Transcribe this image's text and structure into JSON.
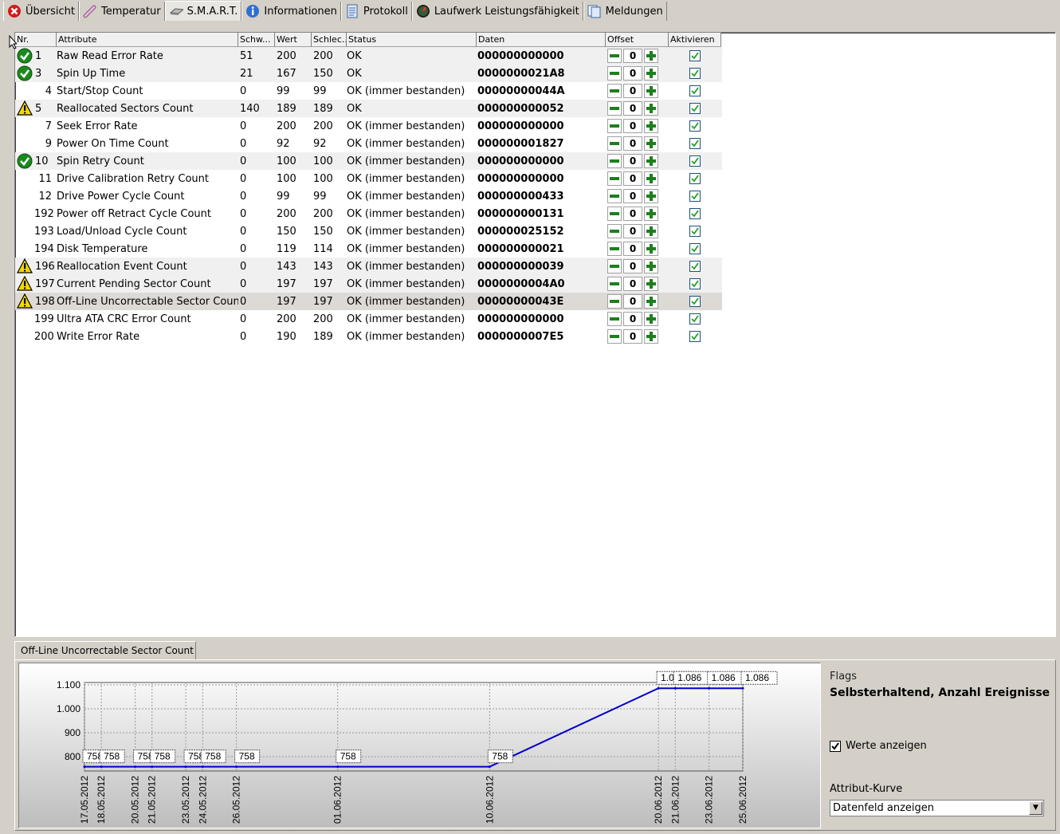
{
  "tabs": [
    {
      "label": "Übersicht",
      "icon": "error-icon"
    },
    {
      "label": "Temperatur",
      "icon": "thermometer-icon"
    },
    {
      "label": "S.M.A.R.T.",
      "icon": "drive-icon",
      "active": true
    },
    {
      "label": "Informationen",
      "icon": "info-icon"
    },
    {
      "label": "Protokoll",
      "icon": "document-icon"
    },
    {
      "label": "Laufwerk Leistungsfähigkeit",
      "icon": "gauge-icon"
    },
    {
      "label": "Meldungen",
      "icon": "messages-icon"
    }
  ],
  "table": {
    "headers": [
      "Nr.",
      "Attribute",
      "Schw...",
      "Wert",
      "Schlec...",
      "Status",
      "Daten",
      "Offset",
      "Aktivieren"
    ],
    "rows": [
      {
        "icon": "ok",
        "nr": "1",
        "attr": "Raw Read Error Rate",
        "sch": "51",
        "wert": "200",
        "schlecht": "200",
        "status": "OK",
        "daten": "000000000000",
        "offset": "0",
        "active": true
      },
      {
        "icon": "ok",
        "nr": "3",
        "attr": "Spin Up Time",
        "sch": "21",
        "wert": "167",
        "schlecht": "150",
        "status": "OK",
        "daten": "0000000021A8",
        "offset": "0",
        "active": true
      },
      {
        "icon": "",
        "nr": "4",
        "attr": "Start/Stop Count",
        "sch": "0",
        "wert": "99",
        "schlecht": "99",
        "status": "OK (immer bestanden)",
        "daten": "00000000044A",
        "offset": "0",
        "active": true
      },
      {
        "icon": "warn",
        "nr": "5",
        "attr": "Reallocated Sectors Count",
        "sch": "140",
        "wert": "189",
        "schlecht": "189",
        "status": "OK",
        "daten": "000000000052",
        "offset": "0",
        "active": true
      },
      {
        "icon": "",
        "nr": "7",
        "attr": "Seek Error Rate",
        "sch": "0",
        "wert": "200",
        "schlecht": "200",
        "status": "OK (immer bestanden)",
        "daten": "000000000000",
        "offset": "0",
        "active": true
      },
      {
        "icon": "",
        "nr": "9",
        "attr": "Power On Time Count",
        "sch": "0",
        "wert": "92",
        "schlecht": "92",
        "status": "OK (immer bestanden)",
        "daten": "000000001827",
        "offset": "0",
        "active": true
      },
      {
        "icon": "ok",
        "nr": "10",
        "attr": "Spin Retry Count",
        "sch": "0",
        "wert": "100",
        "schlecht": "100",
        "status": "OK (immer bestanden)",
        "daten": "000000000000",
        "offset": "0",
        "active": true
      },
      {
        "icon": "",
        "nr": "11",
        "attr": "Drive Calibration Retry Count",
        "sch": "0",
        "wert": "100",
        "schlecht": "100",
        "status": "OK (immer bestanden)",
        "daten": "000000000000",
        "offset": "0",
        "active": true
      },
      {
        "icon": "",
        "nr": "12",
        "attr": "Drive Power Cycle Count",
        "sch": "0",
        "wert": "99",
        "schlecht": "99",
        "status": "OK (immer bestanden)",
        "daten": "000000000433",
        "offset": "0",
        "active": true
      },
      {
        "icon": "",
        "nr": "192",
        "attr": "Power off Retract Cycle Count",
        "sch": "0",
        "wert": "200",
        "schlecht": "200",
        "status": "OK (immer bestanden)",
        "daten": "000000000131",
        "offset": "0",
        "active": true
      },
      {
        "icon": "",
        "nr": "193",
        "attr": "Load/Unload Cycle Count",
        "sch": "0",
        "wert": "150",
        "schlecht": "150",
        "status": "OK (immer bestanden)",
        "daten": "000000025152",
        "offset": "0",
        "active": true
      },
      {
        "icon": "",
        "nr": "194",
        "attr": "Disk Temperature",
        "sch": "0",
        "wert": "119",
        "schlecht": "114",
        "status": "OK (immer bestanden)",
        "daten": "000000000021",
        "offset": "0",
        "active": true
      },
      {
        "icon": "warn",
        "nr": "196",
        "attr": "Reallocation Event Count",
        "sch": "0",
        "wert": "143",
        "schlecht": "143",
        "status": "OK (immer bestanden)",
        "daten": "000000000039",
        "offset": "0",
        "active": true
      },
      {
        "icon": "warn",
        "nr": "197",
        "attr": "Current Pending Sector Count",
        "sch": "0",
        "wert": "197",
        "schlecht": "197",
        "status": "OK (immer bestanden)",
        "daten": "0000000004A0",
        "offset": "0",
        "active": true
      },
      {
        "icon": "warn",
        "nr": "198",
        "attr": "Off-Line Uncorrectable Sector Count",
        "sch": "0",
        "wert": "197",
        "schlecht": "197",
        "status": "OK (immer bestanden)",
        "daten": "00000000043E",
        "offset": "0",
        "active": true,
        "selected": true
      },
      {
        "icon": "",
        "nr": "199",
        "attr": "Ultra ATA CRC Error Count",
        "sch": "0",
        "wert": "200",
        "schlecht": "200",
        "status": "OK (immer bestanden)",
        "daten": "000000000000",
        "offset": "0",
        "active": true
      },
      {
        "icon": "",
        "nr": "200",
        "attr": "Write Error Rate",
        "sch": "0",
        "wert": "190",
        "schlecht": "189",
        "status": "OK (immer bestanden)",
        "daten": "0000000007E5",
        "offset": "0",
        "active": true
      }
    ]
  },
  "bottom_tab": "Off-Line Uncorrectable Sector Count",
  "side": {
    "flags_label": "Flags",
    "flags_value": "Selbsterhaltend, Anzahl Ereignisse",
    "show_values_label": "Werte anzeigen",
    "show_values_checked": true,
    "curve_label": "Attribut-Kurve",
    "curve_value": "Datenfeld anzeigen"
  },
  "colors": {
    "line": "#0000cc",
    "ok": "#1a8a1a",
    "warn": "#f5d800",
    "plusminus": "#1e7f1e"
  },
  "chart_data": {
    "type": "line",
    "x": [
      "17.05.2012",
      "18.05.2012",
      "20.05.2012",
      "21.05.2012",
      "23.05.2012",
      "24.05.2012",
      "26.05.2012",
      "01.06.2012",
      "10.06.2012",
      "20.06.2012",
      "21.06.2012",
      "23.06.2012",
      "25.06.2012"
    ],
    "series": [
      {
        "values": [
          758,
          758,
          758,
          758,
          758,
          758,
          758,
          758,
          758,
          1086,
          1086,
          1086,
          1086
        ]
      }
    ],
    "point_labels": [
      "758",
      "758",
      "758",
      "758",
      "758",
      "758",
      "758",
      "758",
      "758",
      "1.086",
      "1.086",
      "1.086",
      "1.086"
    ],
    "yticks": [
      "1.100",
      "1.000",
      "900",
      "800"
    ],
    "ytick_values": [
      1100,
      1000,
      900,
      800
    ],
    "ylim": [
      740,
      1110
    ],
    "grid": true
  }
}
